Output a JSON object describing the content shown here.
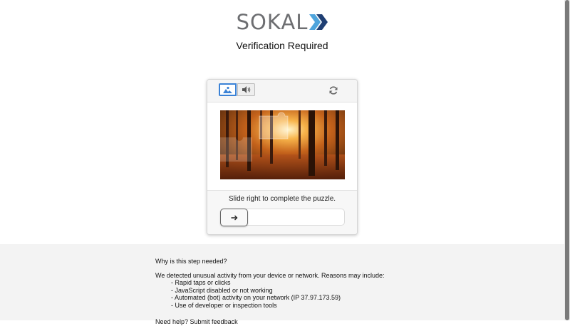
{
  "header": {
    "logo_text": "SOKAL",
    "title": "Verification Required"
  },
  "captcha": {
    "instruction": "Slide right to complete the puzzle.",
    "modes": [
      "image-icon",
      "audio-icon"
    ],
    "selected_mode": "image",
    "refresh_icon": "refresh-icon",
    "slider_progress": 0,
    "accent_color": "#3b82d6"
  },
  "info": {
    "question": "Why is this step needed?",
    "intro": "We detected unusual activity from your device or network. Reasons may include:",
    "reasons": [
      "Rapid taps or clicks",
      "JavaScript disabled or not working",
      "Automated (bot) activity on your network (IP 37.97.173.59)",
      "Use of developer or inspection tools"
    ],
    "footer": "Need help? Submit feedback"
  },
  "colors": {
    "logo_gray": "#6d6e71",
    "logo_blue_dark": "#1f3f73",
    "logo_blue_light": "#4ea4dc"
  }
}
